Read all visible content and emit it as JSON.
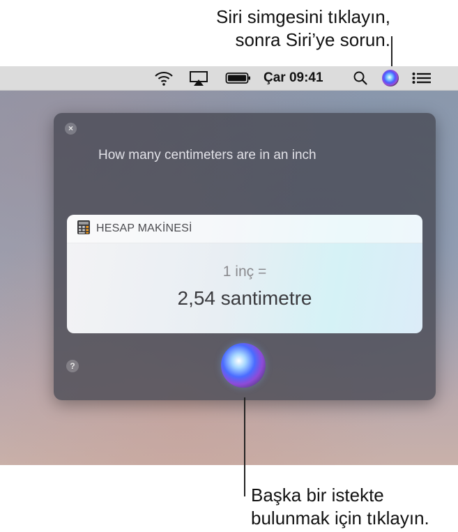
{
  "callouts": {
    "top_line1": "Siri simgesini tıklayın,",
    "top_line2": "sonra Siri’ye sorun.",
    "bottom_line1": "Başka bir istekte",
    "bottom_line2": "bulunmak için tıklayın."
  },
  "menubar": {
    "clock": "Çar 09:41",
    "icons": [
      "wifi-icon",
      "airplay-icon",
      "battery-icon",
      "search-icon",
      "siri-icon",
      "notification-center-icon"
    ]
  },
  "siri": {
    "close_label": "×",
    "query": "How many centimeters are in an inch",
    "help_label": "?",
    "card": {
      "app_icon": "calculator-icon",
      "title": "HESAP MAKİNESİ",
      "line1": "1 inç =",
      "line2": "2,54 santimetre"
    }
  }
}
